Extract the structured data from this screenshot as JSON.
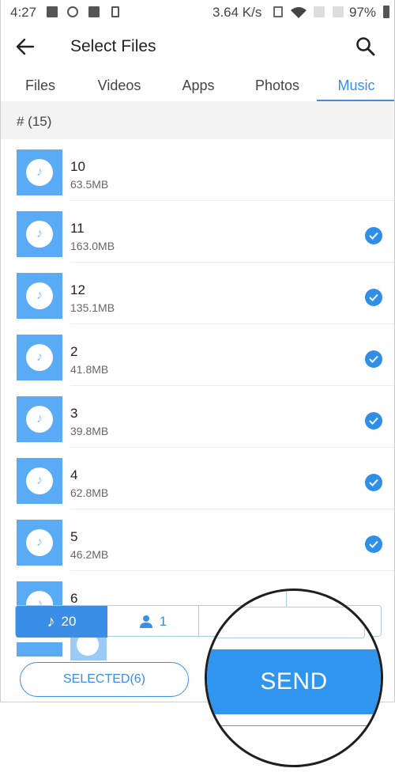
{
  "status_bar": {
    "time": "4:27",
    "left_icons": [
      "screen-icon",
      "sync-icon",
      "image-icon",
      "phone-download-icon"
    ],
    "network_rate": "3.64 K/s",
    "right_icons": [
      "vibrate-icon",
      "wifi-icon",
      "no-sim-icon",
      "no-sim-icon"
    ],
    "battery": "97%"
  },
  "app_bar": {
    "back_icon": "arrow-left-icon",
    "title": "Select Files",
    "search_icon": "search-icon"
  },
  "tabs": [
    {
      "label": "Files",
      "active": false
    },
    {
      "label": "Videos",
      "active": false
    },
    {
      "label": "Apps",
      "active": false
    },
    {
      "label": "Photos",
      "active": false
    },
    {
      "label": "Music",
      "active": true
    }
  ],
  "section": {
    "label": "# (15)"
  },
  "files": [
    {
      "name": "10",
      "size": "63.5MB",
      "selected": false
    },
    {
      "name": "11",
      "size": "163.0MB",
      "selected": true
    },
    {
      "name": "12",
      "size": "135.1MB",
      "selected": true
    },
    {
      "name": "2",
      "size": "41.8MB",
      "selected": true
    },
    {
      "name": "3",
      "size": "39.8MB",
      "selected": true
    },
    {
      "name": "4",
      "size": "62.8MB",
      "selected": true
    },
    {
      "name": "5",
      "size": "46.2MB",
      "selected": true
    },
    {
      "name": "6",
      "size": "",
      "selected": false
    }
  ],
  "selection_bar": {
    "music_count": "20",
    "contact_count": "1"
  },
  "buttons": {
    "selected": "SELECTED(6)",
    "send": "SEND"
  },
  "colors": {
    "accent": "#3a8ee6",
    "send": "#2f95ee",
    "thumb": "#5aabf5"
  }
}
